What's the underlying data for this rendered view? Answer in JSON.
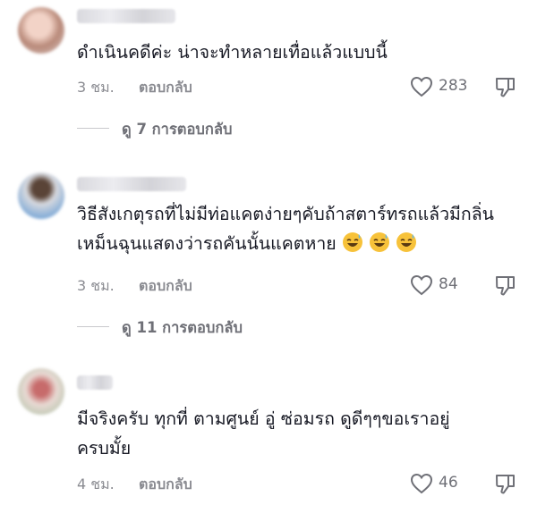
{
  "comments": [
    {
      "text": "ดำเนินคดีค่ะ น่าจะทำหลายเทื่อแล้วแบบนี้",
      "time": "3 ชม.",
      "reply_label": "ตอบกลับ",
      "likes": "283",
      "view_replies": "ดู 7 การตอบกลับ"
    },
    {
      "text": "วิธีสังเกตุรถที่ไม่มีท่อแคตง่ายๆคับถ้าสตาร์ทรถแล้วมีกลิ่นเหม็นฉุนแสดงว่ารถคันนั้นแคตหาย",
      "emojis": [
        "😅",
        "😅",
        "😅"
      ],
      "time": "3 ชม.",
      "reply_label": "ตอบกลับ",
      "likes": "84",
      "view_replies": "ดู 11 การตอบกลับ"
    },
    {
      "text": "มีจริงครับ ทุกที่ ตามศูนย์ อู่ ซ่อมรถ ดูดีๆๆขอเราอยู่ครบมั้ย",
      "time": "4 ชม.",
      "reply_label": "ตอบกลับ",
      "likes": "46"
    }
  ],
  "icons": {
    "like": "heart-outline-icon",
    "dislike": "thumbs-down-icon"
  },
  "colors": {
    "text": "#161823",
    "muted": "#8a8b91",
    "emoji": "#f7c23a"
  }
}
